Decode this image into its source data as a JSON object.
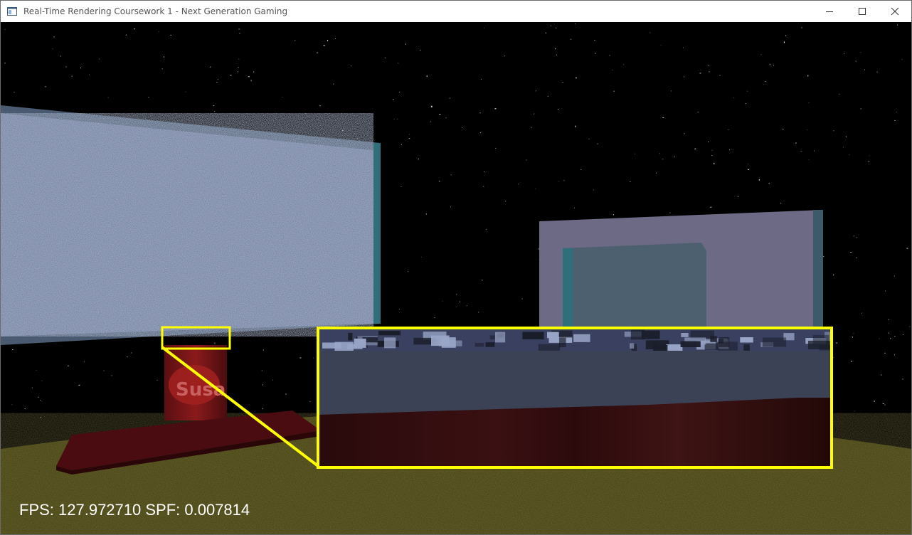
{
  "window": {
    "title": "Real-Time Rendering Coursework 1 - Next Generation Gaming",
    "controls": [
      "minimize-icon",
      "maximize-icon",
      "close-icon"
    ]
  },
  "scene": {
    "objects": [
      "starfield",
      "left-monitor-static-screen",
      "right-monitor-screen",
      "monitor-stand",
      "yellow-ground-plane",
      "magnifier-zoom-inset"
    ],
    "stand_logo_text": "Susa",
    "colors": {
      "sky": "#000000",
      "static_screen": "#6f7d9e",
      "monitor_frame": "#4f5f76",
      "right_screen": "#8a8aa0",
      "stand": "#7a1618",
      "ground": "#55501a",
      "highlight": "#ffff00"
    }
  },
  "hud": {
    "fps_text": "FPS: 127.972710 SPF: 0.007814"
  }
}
